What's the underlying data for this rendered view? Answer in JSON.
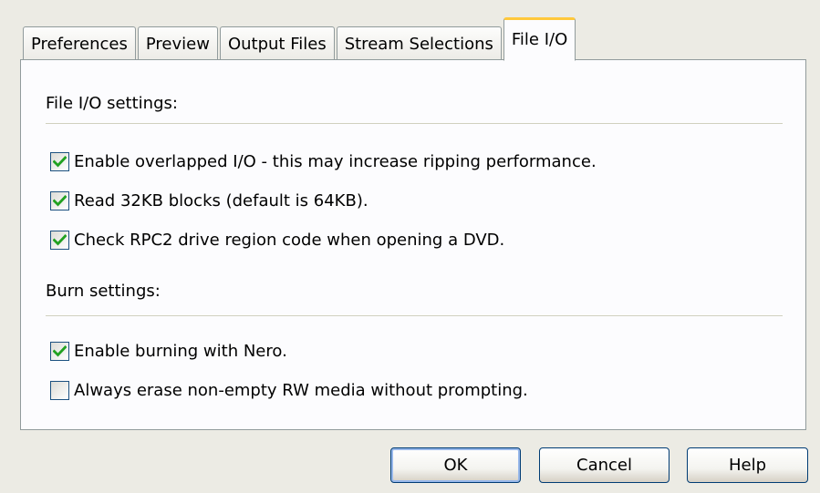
{
  "tabs": [
    {
      "label": "Preferences",
      "active": false
    },
    {
      "label": "Preview",
      "active": false
    },
    {
      "label": "Output Files",
      "active": false
    },
    {
      "label": "Stream Selections",
      "active": false
    },
    {
      "label": "File I/O",
      "active": true
    }
  ],
  "file_io": {
    "heading": "File I/O settings:",
    "options": [
      {
        "label": "Enable overlapped I/O - this may increase ripping performance.",
        "checked": true
      },
      {
        "label": "Read 32KB blocks (default is 64KB).",
        "checked": true
      },
      {
        "label": "Check RPC2 drive region code when opening a DVD.",
        "checked": true
      }
    ]
  },
  "burn": {
    "heading": "Burn settings:",
    "options": [
      {
        "label": "Enable burning with Nero.",
        "checked": true
      },
      {
        "label": "Always erase non-empty RW media without prompting.",
        "checked": false
      }
    ]
  },
  "buttons": {
    "ok": "OK",
    "cancel": "Cancel",
    "help": "Help"
  },
  "colors": {
    "active_tab_accent": "#ffc83c",
    "checkmark": "#21a121",
    "button_border": "#003c74"
  }
}
